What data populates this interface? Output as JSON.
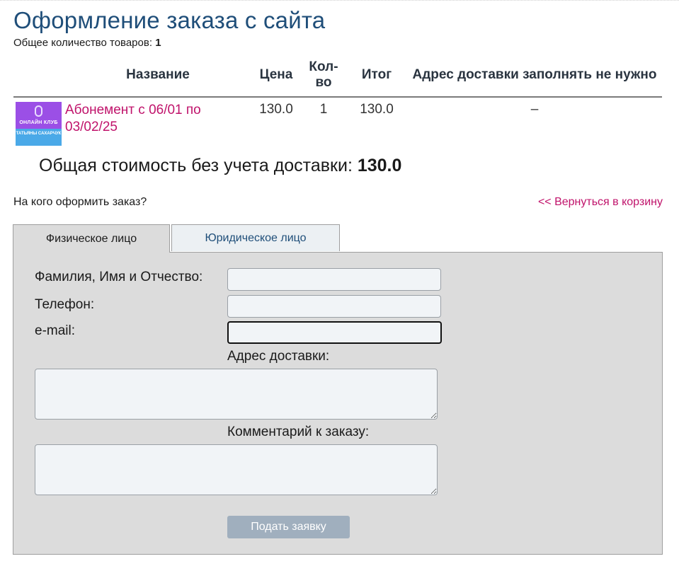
{
  "page": {
    "title": "Оформление заказа с сайта",
    "items_count_label": "Общее количество товаров:",
    "items_count": "1"
  },
  "cart": {
    "columns": {
      "name": "Название",
      "price": "Цена",
      "qty": "Кол-во",
      "total": "Итог",
      "address": "Адрес доставки заполнять не нужно"
    },
    "rows": [
      {
        "thumb_title": "ОНЛАЙН КЛУБ",
        "thumb_sub": "ТАТЬЯНЫ САХАРЧУК",
        "name": "Абонемент с 06/01 по 03/02/25",
        "price": "130.0",
        "qty": "1",
        "total": "130.0",
        "address": "–"
      }
    ]
  },
  "summary": {
    "label": "Общая стоимость без учета доставки:",
    "value": "130.0"
  },
  "order": {
    "who_label": "На кого оформить заказ?",
    "back_link": "<< Вернуться в корзину",
    "tabs": [
      {
        "label": "Физическое лицо",
        "active": true
      },
      {
        "label": "Юридическое лицо",
        "active": false
      }
    ],
    "form": {
      "fio_label": "Фамилия, Имя и Отчество:",
      "fio_value": "",
      "phone_label": "Телефон:",
      "phone_value": "",
      "email_label": "e-mail:",
      "email_value": "",
      "address_label": "Адрес доставки:",
      "comment_label": "Комментарий к заказу:",
      "submit_label": "Подать заявку"
    }
  },
  "colors": {
    "title": "#1f4e79",
    "link": "#c0136b",
    "panel": "#dcdcdc",
    "button": "#a0afbe"
  }
}
